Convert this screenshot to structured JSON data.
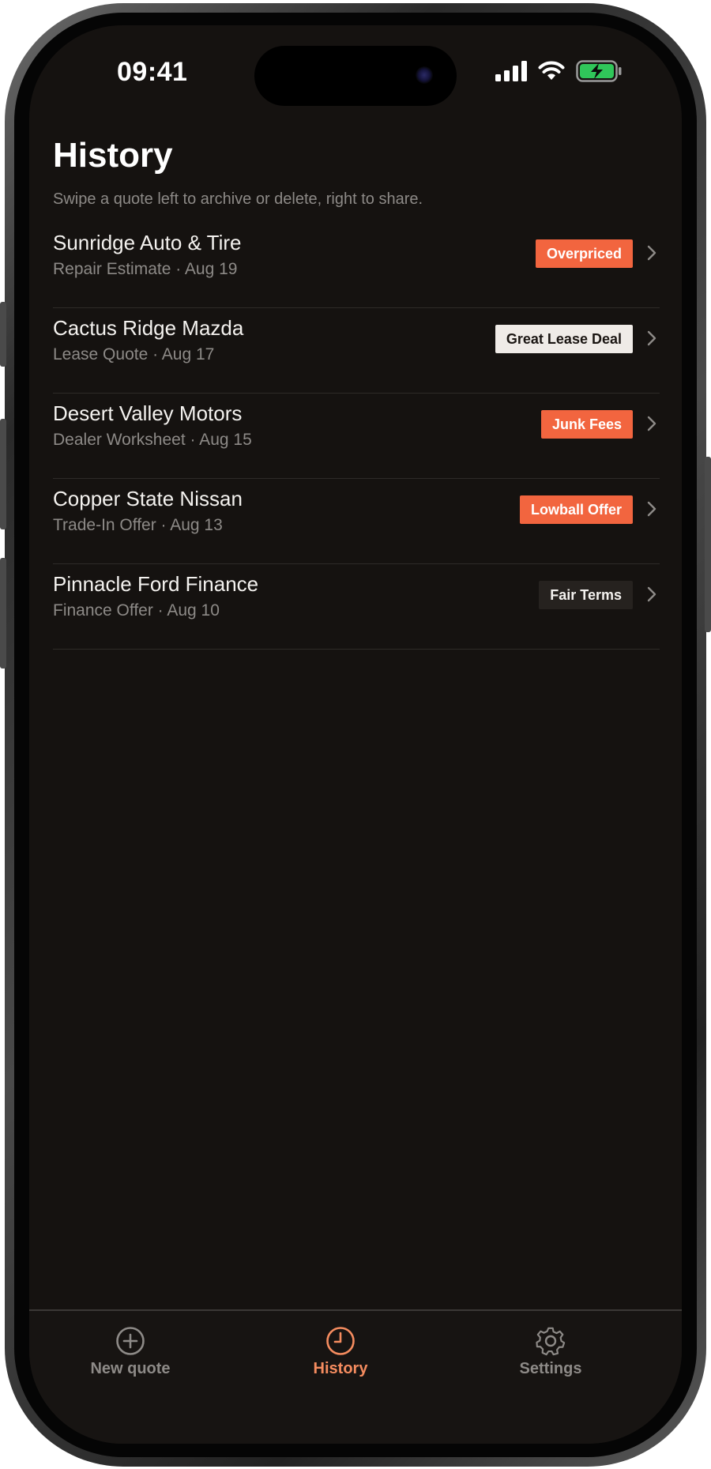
{
  "status_bar": {
    "time": "09:41",
    "icons": [
      "cellular-signal-icon",
      "wifi-icon",
      "battery-charging-icon"
    ],
    "battery_color": "#30c75a"
  },
  "header": {
    "title": "History",
    "subtitle": "Swipe a quote left to archive or delete, right to share."
  },
  "quotes": [
    {
      "name": "Sunridge Auto & Tire",
      "meta": "Repair Estimate · Aug 19",
      "badge": "Overpriced",
      "badge_style": "warn"
    },
    {
      "name": "Cactus Ridge Mazda",
      "meta": "Lease Quote · Aug 17",
      "badge": "Great Lease Deal",
      "badge_style": "light"
    },
    {
      "name": "Desert Valley Motors",
      "meta": "Dealer Worksheet · Aug 15",
      "badge": "Junk Fees",
      "badge_style": "warn"
    },
    {
      "name": "Copper State Nissan",
      "meta": "Trade-In Offer · Aug 13",
      "badge": "Lowball Offer",
      "badge_style": "warn"
    },
    {
      "name": "Pinnacle Ford Finance",
      "meta": "Finance Offer · Aug 10",
      "badge": "Fair Terms",
      "badge_style": "dark"
    }
  ],
  "tabbar": {
    "tabs": [
      {
        "label": "New quote",
        "icon": "plus-circle-icon",
        "active": false
      },
      {
        "label": "History",
        "icon": "clock-icon",
        "active": true
      },
      {
        "label": "Settings",
        "icon": "gear-icon",
        "active": false
      }
    ]
  },
  "colors": {
    "background": "#151210",
    "accent": "#f58c5f",
    "warning_badge": "#f2653f",
    "light_badge": "#efebe7",
    "dark_badge": "#26221f",
    "muted_text": "#8d8a87"
  }
}
